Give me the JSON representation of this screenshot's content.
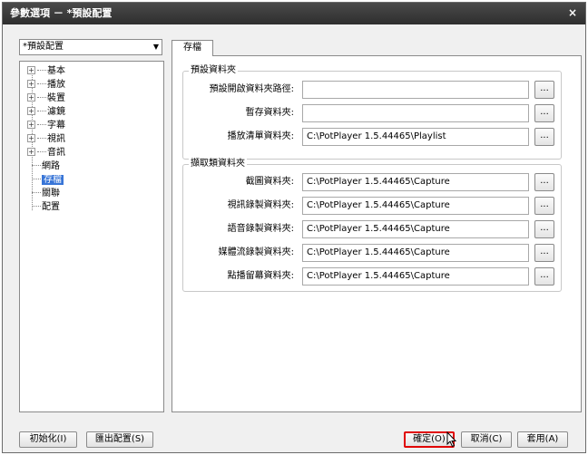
{
  "window": {
    "title": "參數選項 － *預設配置",
    "close_glyph": "×"
  },
  "preset": {
    "selected": "*預設配置"
  },
  "tree": {
    "items": [
      {
        "label": "基本",
        "expandable": true
      },
      {
        "label": "播放",
        "expandable": true
      },
      {
        "label": "裝置",
        "expandable": true
      },
      {
        "label": "濾鏡",
        "expandable": true
      },
      {
        "label": "字幕",
        "expandable": true
      },
      {
        "label": "視訊",
        "expandable": true
      },
      {
        "label": "音訊",
        "expandable": true
      },
      {
        "label": "網路",
        "expandable": false
      },
      {
        "label": "存檔",
        "expandable": false,
        "selected": true
      },
      {
        "label": "關聯",
        "expandable": false
      },
      {
        "label": "配置",
        "expandable": false
      }
    ]
  },
  "tab": {
    "label": "存檔"
  },
  "default_folders": {
    "title": "預設資料夾",
    "rows": [
      {
        "label": "預設開啟資料夾路徑:",
        "value": ""
      },
      {
        "label": "暫存資料夾:",
        "value": ""
      },
      {
        "label": "播放清單資料夾:",
        "value": "C:\\PotPlayer 1.5.44465\\Playlist"
      }
    ]
  },
  "capture_folders": {
    "title": "擷取類資料夾",
    "rows": [
      {
        "label": "截圖資料夾:",
        "value": "C:\\PotPlayer 1.5.44465\\Capture"
      },
      {
        "label": "視訊錄製資料夾:",
        "value": "C:\\PotPlayer 1.5.44465\\Capture"
      },
      {
        "label": "語音錄製資料夾:",
        "value": "C:\\PotPlayer 1.5.44465\\Capture"
      },
      {
        "label": "媒體流錄製資料夾:",
        "value": "C:\\PotPlayer 1.5.44465\\Capture"
      },
      {
        "label": "點播留幕資料夾:",
        "value": "C:\\PotPlayer 1.5.44465\\Capture"
      }
    ]
  },
  "browse_label": "...",
  "buttons": {
    "init": "初始化(I)",
    "export": "匯出配置(S)",
    "ok": "確定(O)",
    "cancel": "取消(C)",
    "apply": "套用(A)"
  }
}
